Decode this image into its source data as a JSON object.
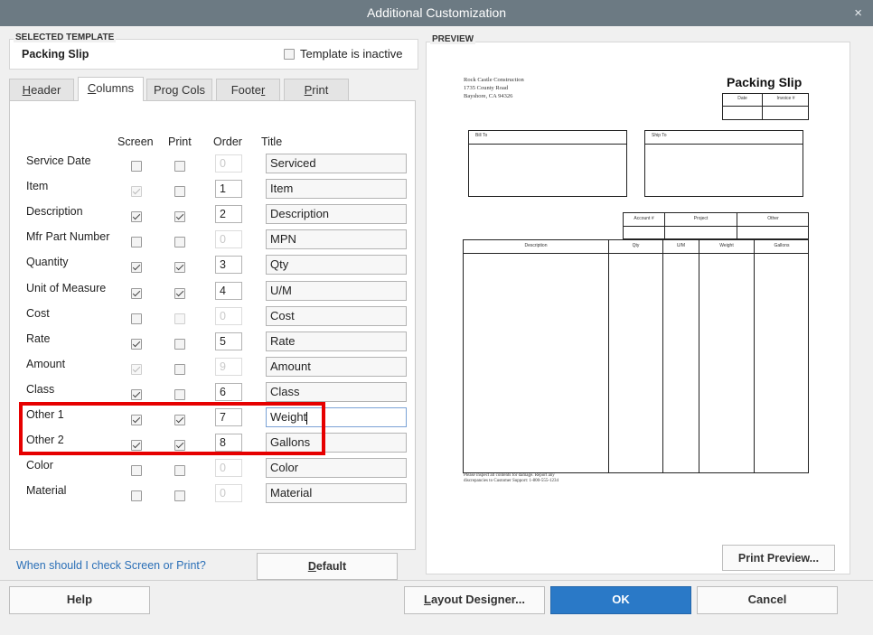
{
  "window": {
    "title": "Additional Customization",
    "close_glyph": "×"
  },
  "selected_template": {
    "section_label": "SELECTED TEMPLATE",
    "name": "Packing Slip",
    "inactive_label": "Template is inactive"
  },
  "tabs": [
    {
      "pre": "",
      "ul": "H",
      "post": "eader"
    },
    {
      "pre": "",
      "ul": "C",
      "post": "olumns"
    },
    {
      "pre": "Pro",
      "ul": "g",
      "post": " Cols"
    },
    {
      "pre": "Foote",
      "ul": "r",
      "post": ""
    },
    {
      "pre": "",
      "ul": "P",
      "post": "rint"
    }
  ],
  "columns": {
    "headers": {
      "screen": "Screen",
      "print": "Print",
      "order": "Order",
      "title": "Title"
    },
    "rows": [
      {
        "label": "Service Date",
        "screen": false,
        "screen_disabled": false,
        "print": false,
        "print_disabled": false,
        "order": "0",
        "order_disabled": true,
        "title": "Serviced"
      },
      {
        "label": "Item",
        "screen": true,
        "screen_disabled": true,
        "print": false,
        "print_disabled": false,
        "order": "1",
        "order_disabled": false,
        "title": "Item"
      },
      {
        "label": "Description",
        "screen": true,
        "screen_disabled": false,
        "print": true,
        "print_disabled": false,
        "order": "2",
        "order_disabled": false,
        "title": "Description"
      },
      {
        "label": "Mfr Part Number",
        "screen": false,
        "screen_disabled": false,
        "print": false,
        "print_disabled": false,
        "order": "0",
        "order_disabled": true,
        "title": "MPN"
      },
      {
        "label": "Quantity",
        "screen": true,
        "screen_disabled": false,
        "print": true,
        "print_disabled": false,
        "order": "3",
        "order_disabled": false,
        "title": "Qty"
      },
      {
        "label": "Unit of Measure",
        "screen": true,
        "screen_disabled": false,
        "print": true,
        "print_disabled": false,
        "order": "4",
        "order_disabled": false,
        "title": "U/M"
      },
      {
        "label": "Cost",
        "screen": false,
        "screen_disabled": false,
        "print": false,
        "print_disabled": true,
        "order": "0",
        "order_disabled": true,
        "title": "Cost"
      },
      {
        "label": "Rate",
        "screen": true,
        "screen_disabled": false,
        "print": false,
        "print_disabled": false,
        "order": "5",
        "order_disabled": false,
        "title": "Rate"
      },
      {
        "label": "Amount",
        "screen": true,
        "screen_disabled": true,
        "print": false,
        "print_disabled": false,
        "order": "9",
        "order_disabled": true,
        "title": "Amount"
      },
      {
        "label": "Class",
        "screen": true,
        "screen_disabled": false,
        "print": false,
        "print_disabled": false,
        "order": "6",
        "order_disabled": false,
        "title": "Class"
      },
      {
        "label": "Other 1",
        "screen": true,
        "screen_disabled": false,
        "print": true,
        "print_disabled": false,
        "order": "7",
        "order_disabled": false,
        "title": "Weight",
        "focused": true
      },
      {
        "label": "Other 2",
        "screen": true,
        "screen_disabled": false,
        "print": true,
        "print_disabled": false,
        "order": "8",
        "order_disabled": false,
        "title": "Gallons"
      },
      {
        "label": "Color",
        "screen": false,
        "screen_disabled": false,
        "print": false,
        "print_disabled": false,
        "order": "0",
        "order_disabled": true,
        "title": "Color"
      },
      {
        "label": "Material",
        "screen": false,
        "screen_disabled": false,
        "print": false,
        "print_disabled": false,
        "order": "0",
        "order_disabled": true,
        "title": "Material"
      }
    ]
  },
  "help_link": "When should I check Screen or Print?",
  "default_button": {
    "ul": "D",
    "post": "efault"
  },
  "preview": {
    "section_label": "PREVIEW",
    "company_lines": [
      "Rock Castle Construction",
      "1735 County Road",
      "Bayshore, CA 94326"
    ],
    "doc_title": "Packing Slip",
    "date_header": "Date",
    "invoice_header": "Invoice #",
    "bill_to": "Bill To",
    "ship_to": "Ship To",
    "info_headers": [
      "Account #",
      "Project",
      "Other"
    ],
    "col_headers": [
      "Description",
      "Qty",
      "U/M",
      "Weight",
      "Gallons"
    ],
    "footer_lines": [
      "Please inspect all contents for damage. Report any",
      "discrepancies to Customer Support: 1-800-555-1234"
    ]
  },
  "print_preview_button": "Print Preview...",
  "bottom_buttons": {
    "help": "Help",
    "layout_designer": {
      "ul": "L",
      "post": "ayout Designer..."
    },
    "ok": "OK",
    "cancel": "Cancel"
  },
  "colors": {
    "titlebar": "#6c7a83",
    "ok_button": "#2a79c7",
    "highlight": "#e60000",
    "link": "#2a6fb7"
  }
}
